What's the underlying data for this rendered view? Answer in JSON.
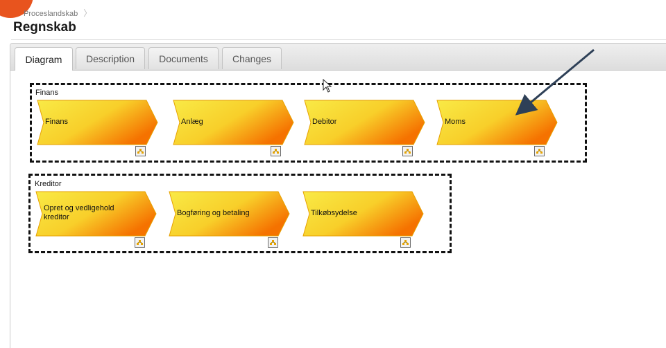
{
  "breadcrumb": {
    "item": "Proceslandskab"
  },
  "page": {
    "title": "Regnskab"
  },
  "tabs": [
    {
      "label": "Diagram",
      "active": true
    },
    {
      "label": "Description",
      "active": false
    },
    {
      "label": "Documents",
      "active": false
    },
    {
      "label": "Changes",
      "active": false
    }
  ],
  "groups": [
    {
      "label": "Finans",
      "processes": [
        {
          "label": "Finans"
        },
        {
          "label": "Anlæg"
        },
        {
          "label": "Debitor"
        },
        {
          "label": "Moms"
        }
      ]
    },
    {
      "label": "Kreditor",
      "processes": [
        {
          "label": "Opret og vedligehold kreditor"
        },
        {
          "label": "Bogføring og betaling"
        },
        {
          "label": "Tilkøbsydelse"
        }
      ]
    }
  ],
  "colors": {
    "process_light": "#f7e33a",
    "process_dark": "#f57b00",
    "badge": "#e8541e",
    "annotation_arrow": "#2e4057"
  },
  "icons": {
    "subprocess": "subprocess-link-icon",
    "cursor": "mouse-pointer-icon",
    "arrow": "annotation-arrow"
  }
}
